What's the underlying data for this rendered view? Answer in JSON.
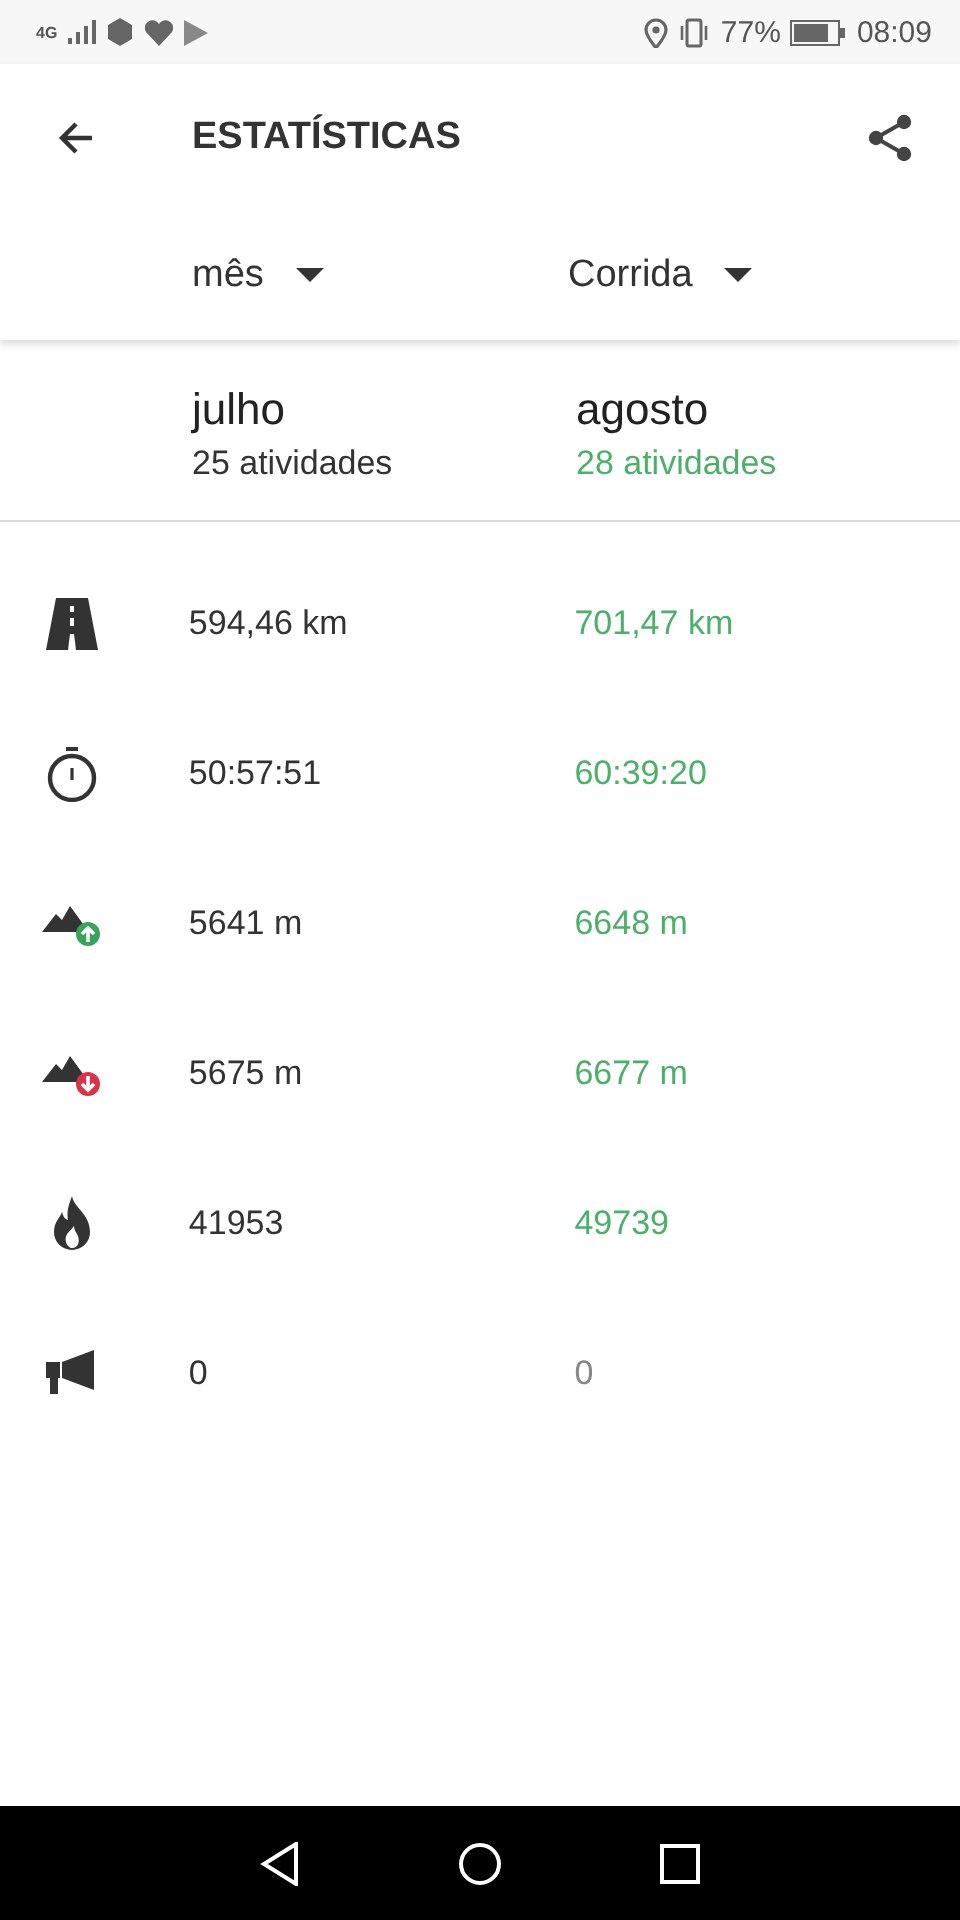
{
  "status_bar": {
    "network": "4G",
    "battery": "77%",
    "time": "08:09"
  },
  "header": {
    "title": "ESTATÍSTICAS"
  },
  "filters": [
    {
      "label": "mês"
    },
    {
      "label": "Corrida"
    }
  ],
  "periods": [
    {
      "month": "julho",
      "activities": "25 atividades",
      "improved": false
    },
    {
      "month": "agosto",
      "activities": "28 atividades",
      "improved": true
    }
  ],
  "rows": [
    {
      "kind": "distance",
      "previous": "594,46 km",
      "current": "701,47 km",
      "improved": true
    },
    {
      "kind": "time",
      "previous": "50:57:51",
      "current": "60:39:20",
      "improved": true
    },
    {
      "kind": "ascent",
      "previous": "5641 m",
      "current": "6648 m",
      "improved": true
    },
    {
      "kind": "descent",
      "previous": "5675 m",
      "current": "6677 m",
      "improved": true
    },
    {
      "kind": "calories",
      "previous": "41953",
      "current": "49739",
      "improved": true
    },
    {
      "kind": "feedback",
      "previous": "0",
      "current": "0",
      "improved": false
    }
  ]
}
